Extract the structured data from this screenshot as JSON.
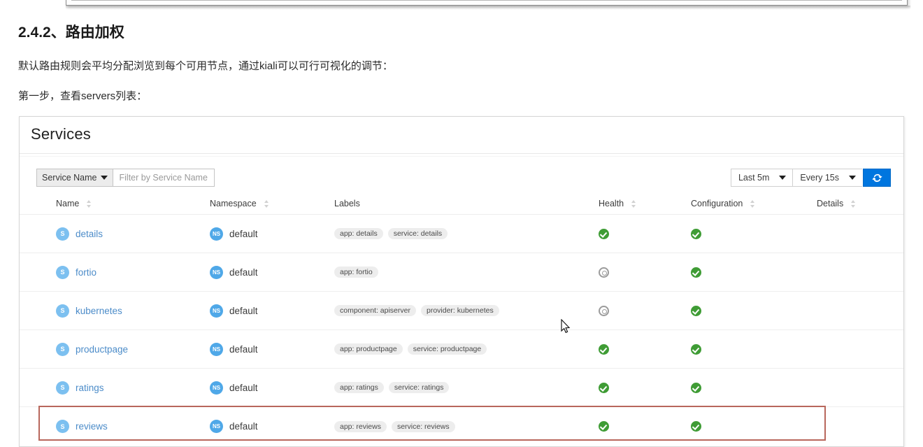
{
  "document": {
    "heading": "2.4.2、路由加权",
    "paragraph1": "默认路由规则会平均分配浏览到每个可用节点，通过kiali可以可行可视化的调节：",
    "paragraph2": "第一步，查看servers列表："
  },
  "panel": {
    "title": "Services",
    "toolbar": {
      "filter_select_label": "Service Name",
      "filter_placeholder": "Filter by Service Name",
      "time_range": "Last 5m",
      "refresh_interval": "Every 15s",
      "refresh_button_label": "refresh-icon"
    },
    "table": {
      "columns": [
        {
          "label": "Name",
          "sortable": true
        },
        {
          "label": "Namespace",
          "sortable": true
        },
        {
          "label": "Labels",
          "sortable": false
        },
        {
          "label": "Health",
          "sortable": true
        },
        {
          "label": "Configuration",
          "sortable": true
        },
        {
          "label": "Details",
          "sortable": true
        }
      ],
      "rows": [
        {
          "badge": "S",
          "name": "details",
          "ns_badge": "NS",
          "namespace": "default",
          "labels": [
            "app: details",
            "service: details"
          ],
          "health": "ok",
          "configuration": "ok",
          "details": "",
          "highlighted": false
        },
        {
          "badge": "S",
          "name": "fortio",
          "ns_badge": "NS",
          "namespace": "default",
          "labels": [
            "app: fortio"
          ],
          "health": "na",
          "configuration": "ok",
          "details": "",
          "highlighted": false
        },
        {
          "badge": "S",
          "name": "kubernetes",
          "ns_badge": "NS",
          "namespace": "default",
          "labels": [
            "component: apiserver",
            "provider: kubernetes"
          ],
          "health": "na",
          "configuration": "ok",
          "details": "",
          "highlighted": false
        },
        {
          "badge": "S",
          "name": "productpage",
          "ns_badge": "NS",
          "namespace": "default",
          "labels": [
            "app: productpage",
            "service: productpage"
          ],
          "health": "ok",
          "configuration": "ok",
          "details": "",
          "highlighted": false
        },
        {
          "badge": "S",
          "name": "ratings",
          "ns_badge": "NS",
          "namespace": "default",
          "labels": [
            "app: ratings",
            "service: ratings"
          ],
          "health": "ok",
          "configuration": "ok",
          "details": "",
          "highlighted": false
        },
        {
          "badge": "S",
          "name": "reviews",
          "ns_badge": "NS",
          "namespace": "default",
          "labels": [
            "app: reviews",
            "service: reviews"
          ],
          "health": "ok",
          "configuration": "ok",
          "details": "",
          "highlighted": true
        }
      ]
    }
  },
  "annotation": {
    "color": "#b8675c"
  },
  "colors": {
    "accent_blue": "#0076df",
    "link_blue": "#4c8cc9",
    "badge_blue": "#7cc0f0",
    "health_ok_green": "#3f9c35",
    "health_na_gray": "#9b9b9b",
    "annotation_red": "#b8675c"
  }
}
